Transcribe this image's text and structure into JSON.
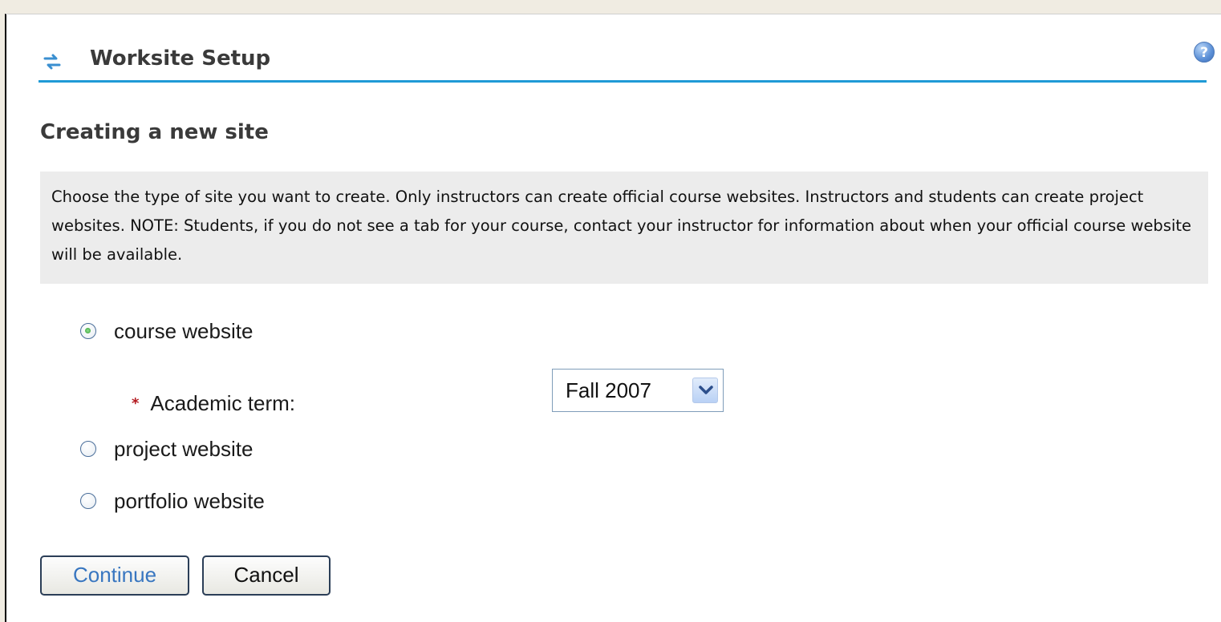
{
  "header": {
    "title": "Worksite Setup",
    "title_icon": "refresh-arrows-icon",
    "help_icon": "help-icon",
    "help_glyph": "?",
    "accent_color": "#1f9ad6"
  },
  "main": {
    "heading": "Creating a new site",
    "instructions": "Choose the type of site you want to create. Only instructors can create official course websites. Instructors and students can create project websites. NOTE: Students, if you do not see a tab for your course, contact your instructor for information about when your official course website will be available.",
    "site_types": [
      {
        "label": "course website",
        "checked": true
      },
      {
        "label": "project website",
        "checked": false
      },
      {
        "label": "portfolio website",
        "checked": false
      }
    ],
    "academic_term": {
      "required_marker": "*",
      "label": "Academic term:",
      "selected": "Fall 2007"
    }
  },
  "buttons": {
    "continue_label": "Continue",
    "cancel_label": "Cancel"
  }
}
